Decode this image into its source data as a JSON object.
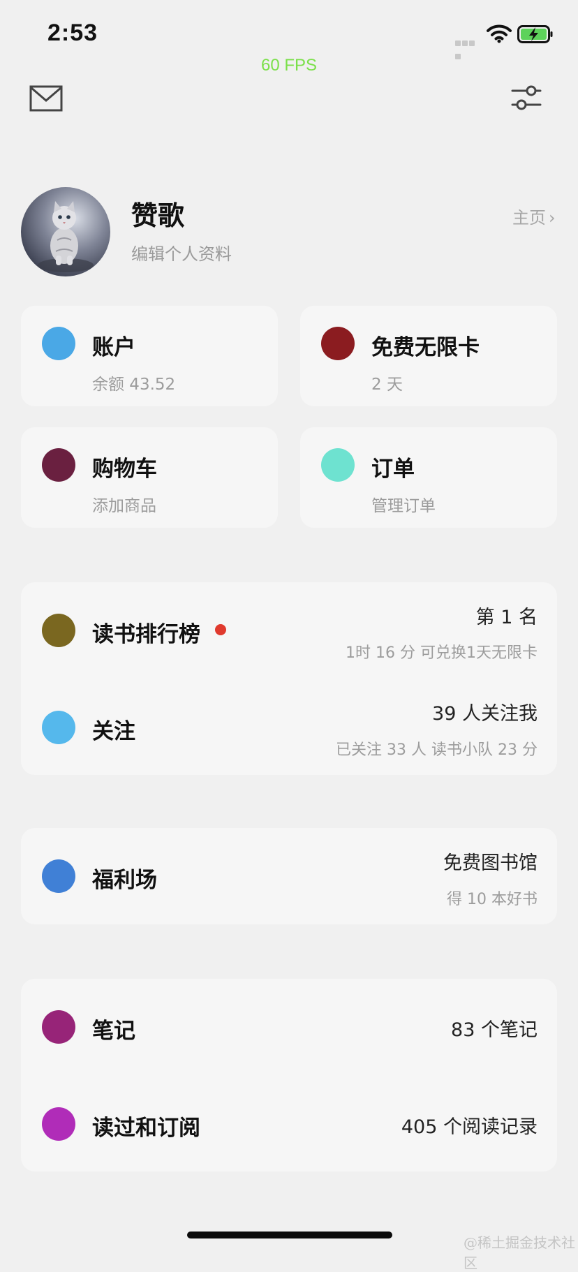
{
  "status_bar": {
    "time": "2:53",
    "fps": "60 FPS",
    "icons": [
      "cellular-signal-icon",
      "wifi-icon",
      "battery-charging-icon"
    ],
    "colors": {
      "fps": "#7be04a",
      "battery": "#5dd25a"
    }
  },
  "header": {
    "left_icon": "mail-icon",
    "right_icon": "settings-sliders-icon"
  },
  "profile": {
    "name": "赞歌",
    "subtitle": "编辑个人资料",
    "home_link": "主页",
    "chevron": "›"
  },
  "grid_cards": [
    {
      "title": "账户",
      "subtitle": "余额 43.52",
      "color": "#4aa8e6"
    },
    {
      "title": "免费无限卡",
      "subtitle": "2 天",
      "color": "#8b1c20"
    },
    {
      "title": "购物车",
      "subtitle": "添加商品",
      "color": "#6a2040"
    },
    {
      "title": "订单",
      "subtitle": "管理订单",
      "color": "#6ee2d0"
    }
  ],
  "group1": [
    {
      "title": "读书排行榜",
      "right_main": "第 1 名",
      "right_sub": "1时 16 分 可兑换1天无限卡",
      "color": "#7a6720",
      "has_badge": true,
      "badge_color": "#e03a2e"
    },
    {
      "title": "关注",
      "right_main": "39 人关注我",
      "right_sub": "已关注 33 人 读书小队 23 分",
      "color": "#55b8ec"
    }
  ],
  "group2": [
    {
      "title": "福利场",
      "right_main": "免费图书馆",
      "right_sub": "得 10 本好书",
      "color": "#4080d6"
    }
  ],
  "group3": [
    {
      "title": "笔记",
      "right_main": "83 个笔记",
      "color": "#972478"
    },
    {
      "title": "读过和订阅",
      "right_main": "405 个阅读记录",
      "color": "#b02cb8"
    }
  ],
  "watermark": "@稀土掘金技术社区"
}
